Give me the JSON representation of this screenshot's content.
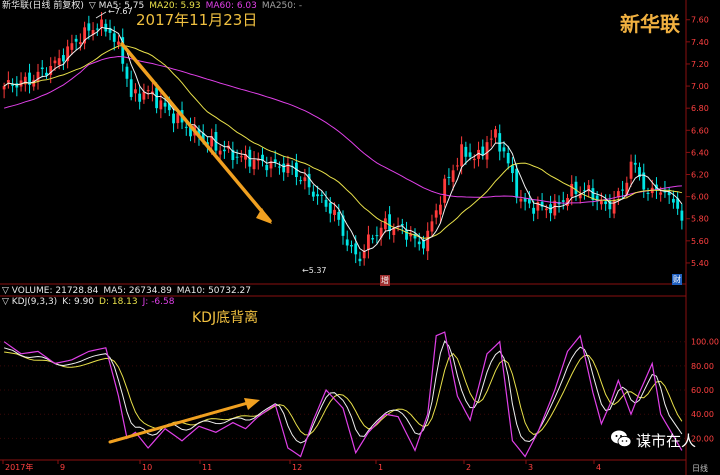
{
  "header": {
    "stock_line": "新华联(日线 前复权)",
    "ma5": "▽ MA5: 5.75",
    "ma20": "MA20: 5.93",
    "ma60": "MA60: 6.03",
    "ma250": "MA250: -",
    "volume_line": "▽ VOLUME: 21728.84",
    "vol_ma5": "MA5: 26734.89",
    "vol_ma10": "MA10: 50732.27",
    "kdj_name": "▽ KDJ(9,3,3)",
    "kdj_k": "K: 9.90",
    "kdj_d": "D: 18.13",
    "kdj_j": "J: -6.58"
  },
  "annotations": {
    "date": "2017年11月23日",
    "kdj_label": "KDJ底背离",
    "high_marker": "←7.67",
    "low_marker": "←5.37",
    "marker_zeng": "增",
    "marker_cai": "财"
  },
  "brand": {
    "name": "新华联",
    "wechat": "谋市在人"
  },
  "footer": {
    "period": "日线"
  },
  "colors": {
    "up": "#ff3b3b",
    "down": "#00e5e5",
    "ma5": "#f0f0f0",
    "ma20": "#e8e04a",
    "ma60": "#e040e8",
    "k": "#f0f0f0",
    "d": "#e8e04a",
    "j": "#e040e8",
    "annotation": "#f0a020"
  },
  "chart_data": [
    {
      "type": "candlestick",
      "title": "新华联(日线 前复权)",
      "y_ticks": [
        "7.60",
        "7.40",
        "7.20",
        "7.00",
        "6.80",
        "6.60",
        "6.40",
        "6.20",
        "6.00",
        "5.80",
        "5.60",
        "5.40"
      ],
      "ylim": [
        5.35,
        7.65
      ],
      "x_ticks": [
        "2017年",
        "9",
        "10",
        "11",
        "12",
        "1",
        "2",
        "3",
        "4"
      ],
      "series_ma": [
        "MA5",
        "MA20",
        "MA60"
      ],
      "close_anchors": [
        [
          0,
          7.0
        ],
        [
          6,
          7.05
        ],
        [
          12,
          7.2
        ],
        [
          18,
          7.45
        ],
        [
          22,
          7.55
        ],
        [
          25,
          7.5
        ],
        [
          28,
          7.25
        ],
        [
          30,
          6.9
        ],
        [
          34,
          6.95
        ],
        [
          38,
          6.8
        ],
        [
          44,
          6.6
        ],
        [
          50,
          6.45
        ],
        [
          56,
          6.35
        ],
        [
          62,
          6.3
        ],
        [
          68,
          6.25
        ],
        [
          74,
          6.0
        ],
        [
          78,
          5.85
        ],
        [
          82,
          5.5
        ],
        [
          84,
          5.45
        ],
        [
          86,
          5.6
        ],
        [
          90,
          5.75
        ],
        [
          94,
          5.7
        ],
        [
          96,
          5.65
        ],
        [
          98,
          5.55
        ],
        [
          100,
          5.65
        ],
        [
          104,
          6.1
        ],
        [
          108,
          6.4
        ],
        [
          112,
          6.35
        ],
        [
          114,
          6.5
        ],
        [
          116,
          6.55
        ],
        [
          118,
          6.4
        ],
        [
          122,
          5.95
        ],
        [
          126,
          5.9
        ],
        [
          130,
          5.9
        ],
        [
          134,
          6.05
        ],
        [
          138,
          6.05
        ],
        [
          142,
          5.9
        ],
        [
          146,
          6.05
        ],
        [
          148,
          6.3
        ],
        [
          150,
          6.2
        ],
        [
          152,
          6.0
        ],
        [
          154,
          6.1
        ],
        [
          156,
          6.0
        ],
        [
          158,
          6.0
        ],
        [
          160,
          5.75
        ]
      ],
      "high": 7.67,
      "low": 5.37
    },
    {
      "type": "line",
      "title": "KDJ(9,3,3)",
      "y_ticks": [
        "100.00",
        "80.00",
        "60.00",
        "40.00",
        "20.00"
      ],
      "ylim": [
        0,
        120
      ],
      "series": [
        {
          "name": "K",
          "values": [
            9.9
          ]
        },
        {
          "name": "D",
          "values": [
            18.13
          ]
        },
        {
          "name": "J",
          "values": [
            -6.58
          ]
        }
      ],
      "j_anchors": [
        [
          0,
          100
        ],
        [
          4,
          90
        ],
        [
          8,
          92
        ],
        [
          12,
          82
        ],
        [
          16,
          85
        ],
        [
          20,
          92
        ],
        [
          24,
          95
        ],
        [
          27,
          55
        ],
        [
          29,
          20
        ],
        [
          31,
          25
        ],
        [
          34,
          12
        ],
        [
          38,
          28
        ],
        [
          42,
          18
        ],
        [
          46,
          30
        ],
        [
          50,
          25
        ],
        [
          54,
          33
        ],
        [
          57,
          28
        ],
        [
          60,
          38
        ],
        [
          64,
          48
        ],
        [
          67,
          12
        ],
        [
          70,
          5
        ],
        [
          73,
          35
        ],
        [
          76,
          60
        ],
        [
          80,
          45
        ],
        [
          83,
          8
        ],
        [
          86,
          25
        ],
        [
          90,
          40
        ],
        [
          93,
          38
        ],
        [
          97,
          10
        ],
        [
          100,
          40
        ],
        [
          102,
          105
        ],
        [
          104,
          108
        ],
        [
          107,
          55
        ],
        [
          110,
          35
        ],
        [
          114,
          90
        ],
        [
          117,
          100
        ],
        [
          120,
          18
        ],
        [
          123,
          5
        ],
        [
          126,
          25
        ],
        [
          130,
          60
        ],
        [
          133,
          92
        ],
        [
          136,
          105
        ],
        [
          139,
          58
        ],
        [
          141,
          32
        ],
        [
          143,
          48
        ],
        [
          145,
          68
        ],
        [
          148,
          40
        ],
        [
          150,
          58
        ],
        [
          153,
          82
        ],
        [
          155,
          40
        ],
        [
          158,
          22
        ],
        [
          160,
          10
        ]
      ]
    }
  ]
}
